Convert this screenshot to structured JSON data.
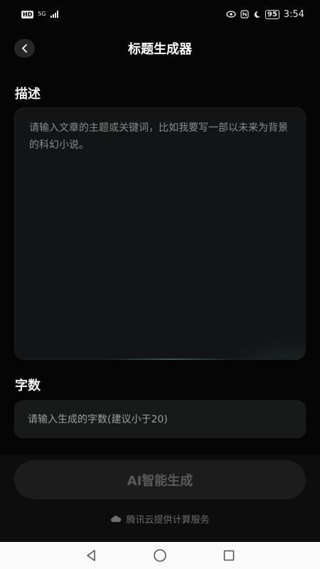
{
  "status_bar": {
    "hd": "HD",
    "network": "5G",
    "battery": "95",
    "time": "3:54",
    "icons": [
      "eye-icon",
      "nfc-icon",
      "moon-icon"
    ]
  },
  "header": {
    "back_icon": "chevron-left-icon",
    "title": "标题生成器"
  },
  "description": {
    "label": "描述",
    "placeholder": "请输入文章的主题或关键词，比如我要写一部以未来为背景的科幻小说。",
    "value": ""
  },
  "word_count": {
    "label": "字数",
    "placeholder": "请输入生成的字数(建议小于20)",
    "value": ""
  },
  "generate_button": {
    "label": "AI智能生成"
  },
  "footer": {
    "icon": "cloud-icon",
    "text": "腾讯云提供计算服务"
  },
  "nav_bar": {
    "icons": [
      "back-triangle-icon",
      "home-circle-icon",
      "recents-square-icon"
    ]
  },
  "colors": {
    "background": "#050505",
    "panel": "#131415",
    "button_disabled": "#1c1c1c",
    "accent_glow": "#3c6e64"
  }
}
